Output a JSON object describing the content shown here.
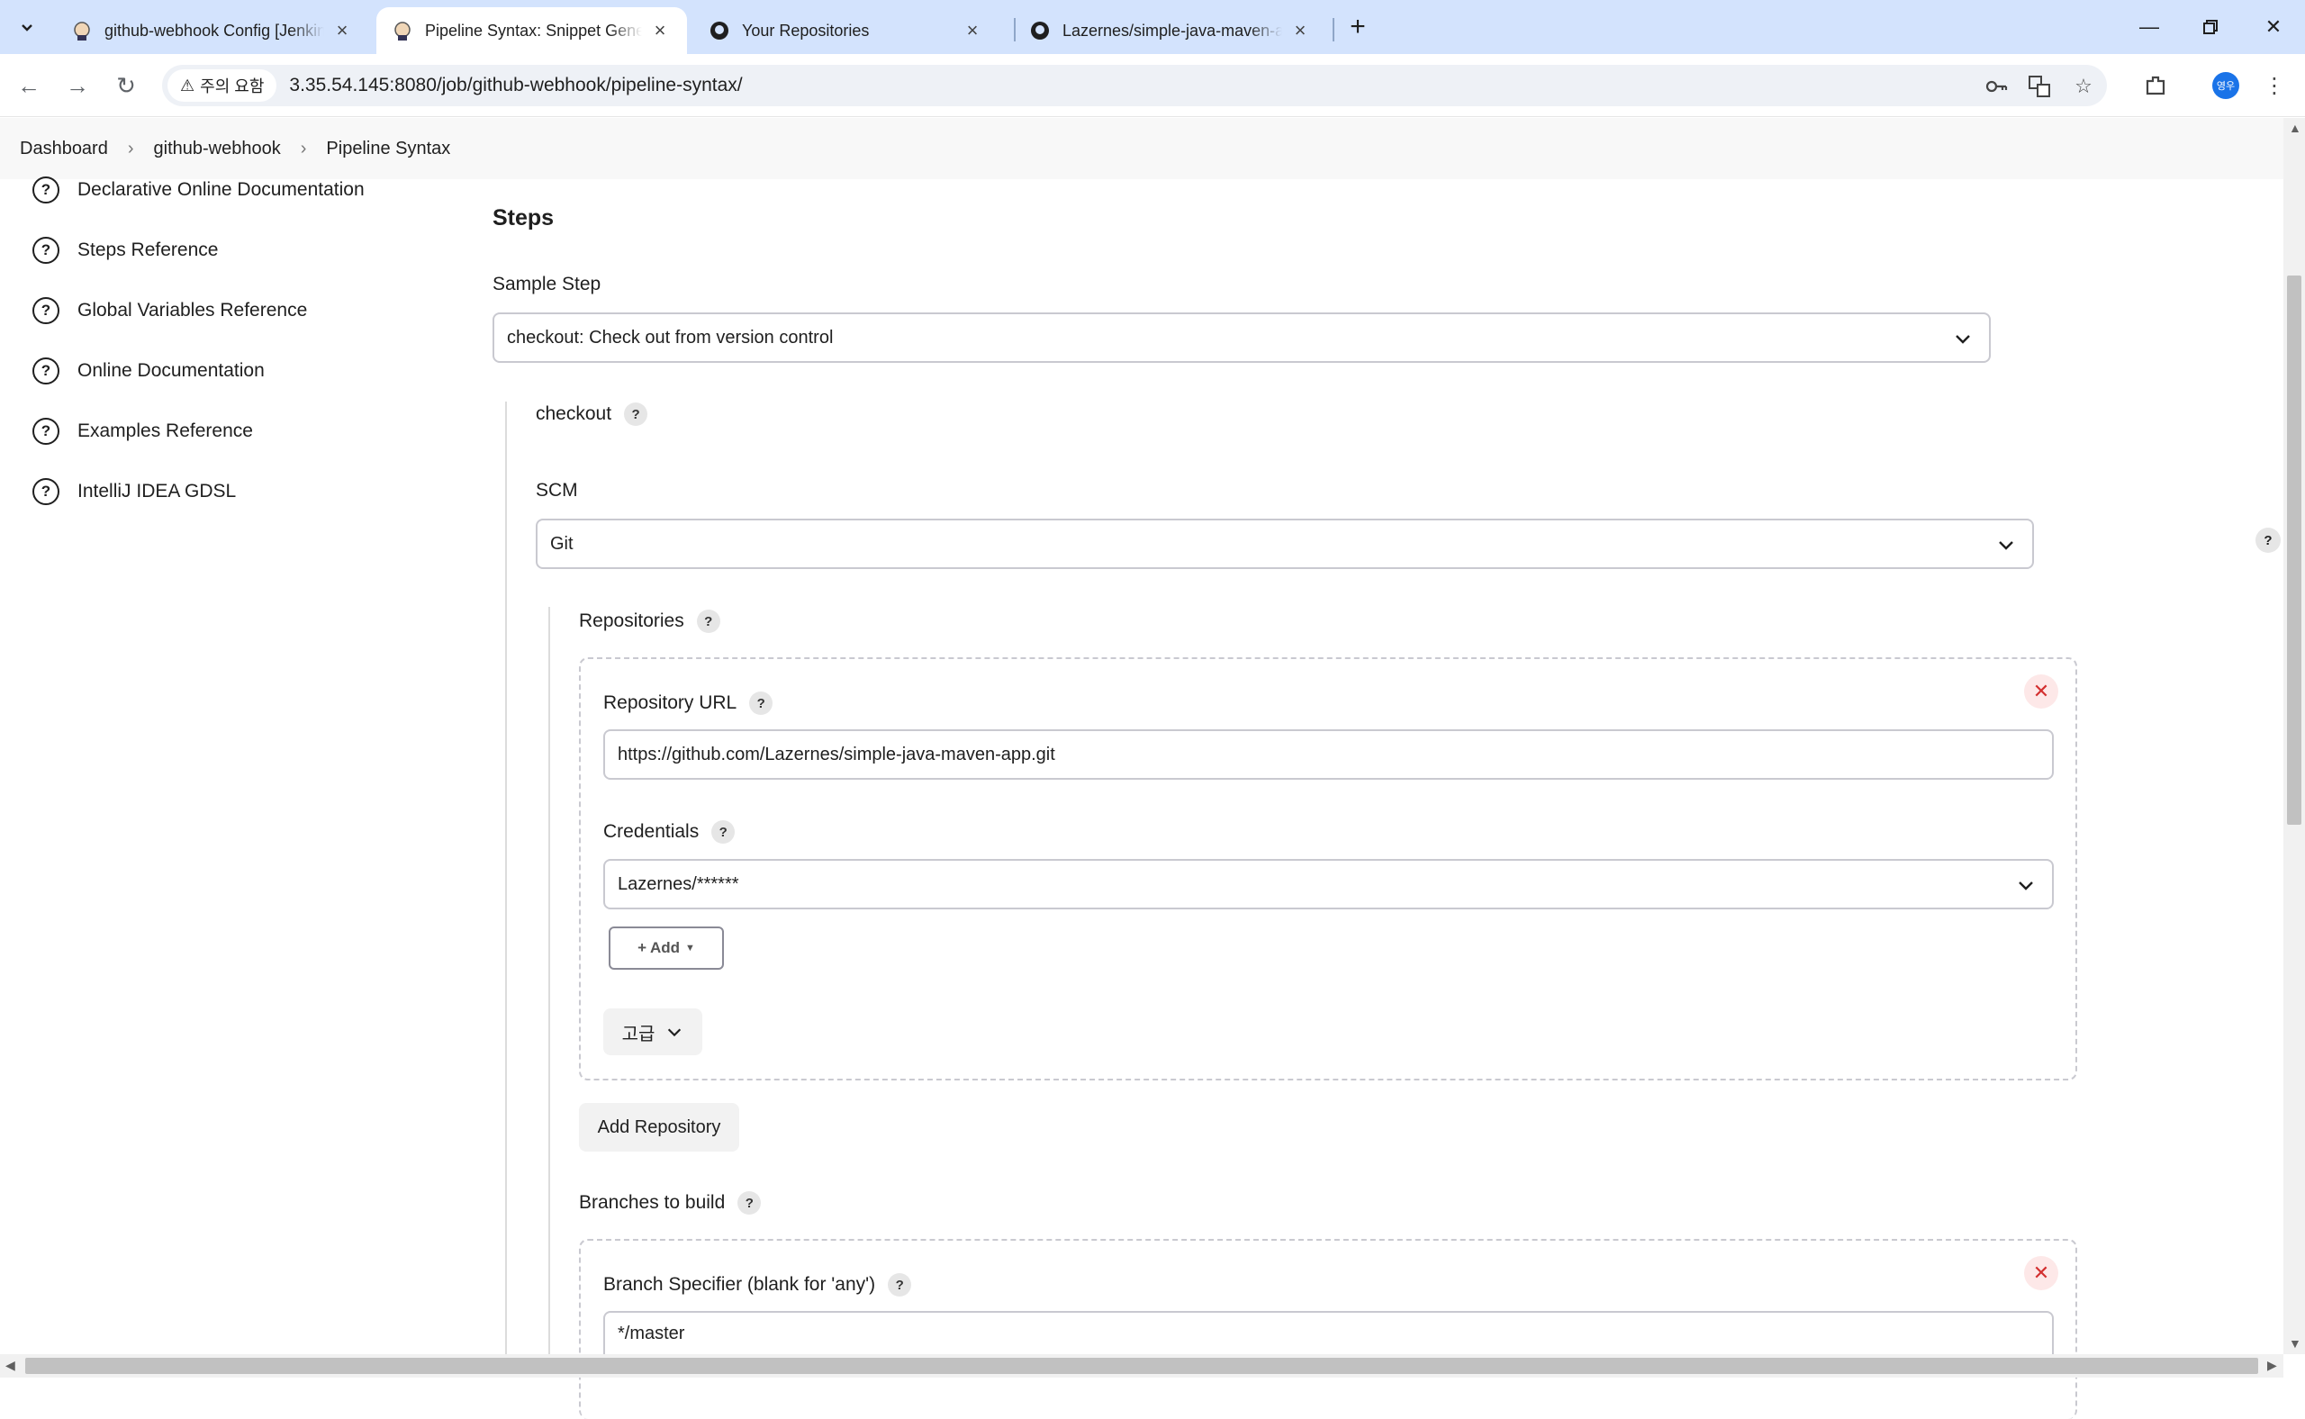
{
  "browser": {
    "tabs": [
      {
        "title": "github-webhook Config [Jenkins]",
        "active": false
      },
      {
        "title": "Pipeline Syntax: Snippet Generator",
        "active": true
      },
      {
        "title": "Your Repositories",
        "active": false
      },
      {
        "title": "Lazernes/simple-java-maven-app",
        "active": false
      }
    ],
    "security_chip": "주의 요함",
    "url": "3.35.54.145:8080/job/github-webhook/pipeline-syntax/",
    "profile_label": "영우"
  },
  "breadcrumb": [
    "Dashboard",
    "github-webhook",
    "Pipeline Syntax"
  ],
  "sidebar": {
    "items": [
      "Declarative Online Documentation",
      "Steps Reference",
      "Global Variables Reference",
      "Online Documentation",
      "Examples Reference",
      "IntelliJ IDEA GDSL"
    ]
  },
  "main": {
    "heading": "Steps",
    "sample_step_label": "Sample Step",
    "sample_step_value": "checkout: Check out from version control",
    "step_name": "checkout",
    "scm_label": "SCM",
    "scm_value": "Git",
    "repositories_label": "Repositories",
    "repo_url_label": "Repository URL",
    "repo_url_value": "https://github.com/Lazernes/simple-java-maven-app.git",
    "credentials_label": "Credentials",
    "credentials_value": "Lazernes/******",
    "add_button": "Add",
    "advanced_button": "고급",
    "add_repository_button": "Add Repository",
    "branches_label": "Branches to build",
    "branch_specifier_label": "Branch Specifier (blank for 'any')",
    "branch_specifier_value": "*/master"
  }
}
